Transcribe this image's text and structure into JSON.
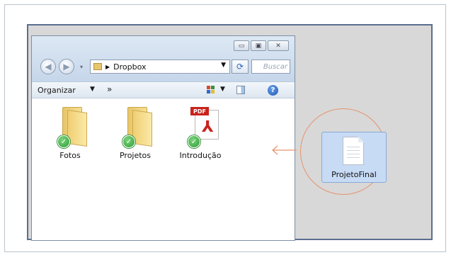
{
  "address_bar": {
    "location": "Dropbox"
  },
  "search": {
    "placeholder": "Buscar"
  },
  "toolbar": {
    "organize_label": "Organizar",
    "more_label": "»"
  },
  "window_buttons": {
    "minimize": "▭",
    "maximize": "▣",
    "close": "✕"
  },
  "files": [
    {
      "name": "Fotos",
      "type": "folder",
      "status": "synced"
    },
    {
      "name": "Projetos",
      "type": "folder",
      "status": "synced"
    },
    {
      "name": "Introdução",
      "type": "pdf",
      "status": "synced",
      "badge": "PDF"
    }
  ],
  "dragged_file": {
    "name": "ProjetoFinal"
  },
  "colors": {
    "accent_circle": "#e6936d",
    "sync_check": "#2e9b36",
    "selection": "#c8dbf5"
  }
}
